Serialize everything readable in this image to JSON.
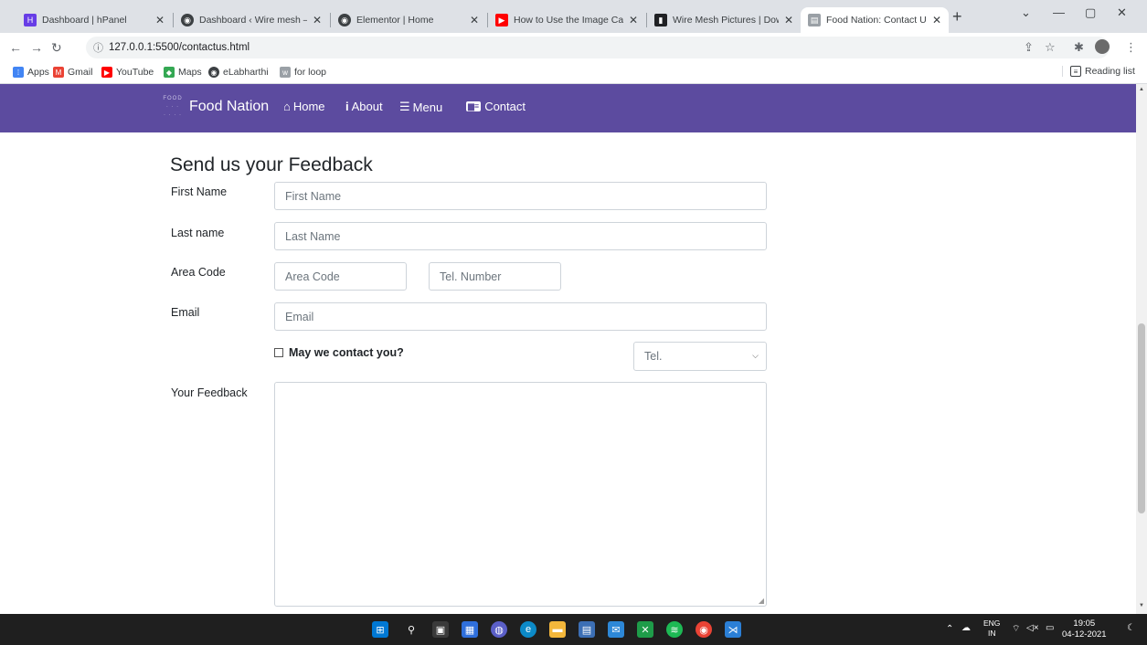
{
  "browser": {
    "tabs": [
      {
        "label": "Dashboard | hPanel",
        "icon": "hpanel-icon",
        "color": "#673de6"
      },
      {
        "label": "Dashboard ‹ Wire mesh —",
        "icon": "wordpress-icon",
        "color": "#3c4043"
      },
      {
        "label": "Elementor | Home",
        "icon": "elementor-icon",
        "color": "#3c4043"
      },
      {
        "label": "How to Use the Image Caro",
        "icon": "youtube-icon",
        "color": "#ff0000"
      },
      {
        "label": "Wire Mesh Pictures | Down",
        "icon": "unsplash-icon",
        "color": "#202124"
      },
      {
        "label": "Food Nation: Contact Us",
        "icon": "food-nation-icon",
        "color": "#9aa0a6"
      }
    ],
    "url": "127.0.0.1:5500/contactus.html",
    "bookmarks": [
      {
        "label": "Apps",
        "icon": "apps-grid-icon",
        "color": "#4285f4"
      },
      {
        "label": "Gmail",
        "icon": "gmail-icon",
        "color": "#ea4335"
      },
      {
        "label": "YouTube",
        "icon": "youtube-icon",
        "color": "#ff0000"
      },
      {
        "label": "Maps",
        "icon": "maps-icon",
        "color": "#34a853"
      },
      {
        "label": "eLabharthi",
        "icon": "globe-icon",
        "color": "#3c4043"
      },
      {
        "label": "for loop",
        "icon": "w3schools-icon",
        "color": "#9aa0a6"
      }
    ],
    "reading_list": "Reading list"
  },
  "page": {
    "brand": "Food Nation",
    "brand_logo_text": "FOOD",
    "nav": [
      {
        "label": "Home",
        "icon": "home-icon"
      },
      {
        "label": "About",
        "icon": "info-icon"
      },
      {
        "label": "Menu",
        "icon": "list-icon"
      },
      {
        "label": "Contact",
        "icon": "contact-card-icon"
      }
    ],
    "accent_color": "#5c4b9f",
    "form": {
      "title": "Send us your Feedback",
      "first_name_label": "First Name",
      "first_name_placeholder": "First Name",
      "last_name_label": "Last name",
      "last_name_placeholder": "Last Name",
      "area_code_label": "Area Code",
      "area_code_placeholder": "Area Code",
      "tel_placeholder": "Tel. Number",
      "email_label": "Email",
      "email_placeholder": "Email",
      "contact_checkbox_label": "May we contact you?",
      "contact_method_selected": "Tel.",
      "feedback_label": "Your Feedback"
    }
  },
  "taskbar": {
    "language": "ENG",
    "region": "IN",
    "time": "19:05",
    "date": "04-12-2021"
  }
}
